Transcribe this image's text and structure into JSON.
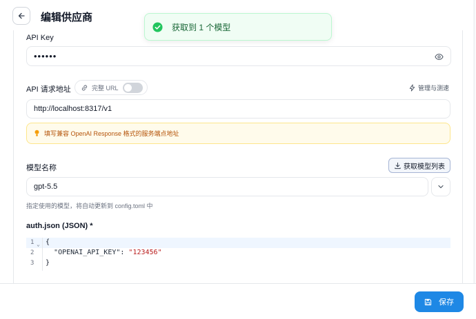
{
  "header": {
    "title": "编辑供应商"
  },
  "toast": {
    "message": "获取到 1 个模型",
    "status_color": "#22c55e"
  },
  "api_key": {
    "label": "API Key",
    "value": "••••••"
  },
  "endpoint": {
    "label": "API 请求地址",
    "full_url_label": "完整 URL",
    "full_url_enabled": false,
    "manage_label": "管理与测速",
    "value": "http://localhost:8317/v1",
    "tip": "填写兼容 OpenAI Response 格式的服务端点地址"
  },
  "model": {
    "label": "模型名称",
    "fetch_label": "获取模型列表",
    "value": "gpt-5.5",
    "hint": "指定使用的模型，将自动更新到 config.toml 中"
  },
  "auth_json": {
    "label": "auth.json (JSON) *",
    "line_numbers": [
      "1",
      "2",
      "3"
    ],
    "lines": {
      "open": "{",
      "key": "\"OPENAI_API_KEY\"",
      "colon": ": ",
      "value": "\"123456\"",
      "close": "}"
    }
  },
  "footer": {
    "save_label": "保存",
    "accent": "#1e88e5"
  }
}
